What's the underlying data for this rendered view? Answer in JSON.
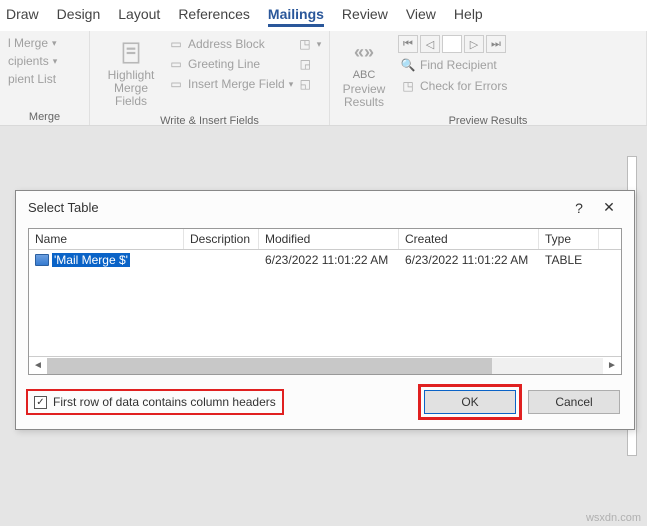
{
  "tabs": {
    "t0": "Draw",
    "t1": "Design",
    "t2": "Layout",
    "t3": "References",
    "t4": "Mailings",
    "t5": "Review",
    "t6": "View",
    "t7": "Help"
  },
  "ribbon": {
    "merge_btn": "l Merge",
    "recipients_btn": "cipients",
    "edit_list": "pient List",
    "merge_group": "Merge",
    "highlight": "Highlight\nMerge Fields",
    "addr_block": "Address Block",
    "greeting": "Greeting Line",
    "insert_field": "Insert Merge Field",
    "write_group": "Write & Insert Fields",
    "abc": "ABC",
    "preview": "Preview\nResults",
    "find_recip": "Find Recipient",
    "check_err": "Check for Errors",
    "preview_group": "Preview Results"
  },
  "dialog": {
    "title": "Select Table",
    "help": "?",
    "close": "✕",
    "cols": {
      "name": "Name",
      "desc": "Description",
      "mod": "Modified",
      "created": "Created",
      "type": "Type"
    },
    "row": {
      "name": "'Mail Merge $'",
      "mod": "6/23/2022 11:01:22 AM",
      "created": "6/23/2022 11:01:22 AM",
      "type": "TABLE"
    },
    "checkbox_label": "First row of data contains column headers",
    "check_mark": "✓",
    "ok": "OK",
    "cancel": "Cancel"
  },
  "watermark": "wsxdn.com"
}
